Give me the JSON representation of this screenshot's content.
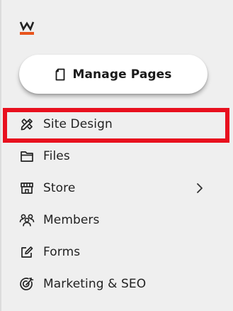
{
  "brand": {
    "logo_icon": "w-logo-icon",
    "accent": "#e8541c"
  },
  "manage_pages": {
    "label": "Manage Pages",
    "icon": "page-icon"
  },
  "nav": {
    "items": [
      {
        "label": "Site Design",
        "icon": "design-tools-icon"
      },
      {
        "label": "Files",
        "icon": "folder-icon"
      },
      {
        "label": "Store",
        "icon": "store-icon",
        "has_submenu": true
      },
      {
        "label": "Members",
        "icon": "members-icon"
      },
      {
        "label": "Forms",
        "icon": "form-edit-icon"
      },
      {
        "label": "Marketing & SEO",
        "icon": "target-icon"
      }
    ]
  },
  "highlight": {
    "color": "#e8101e",
    "target": "Site Design"
  }
}
